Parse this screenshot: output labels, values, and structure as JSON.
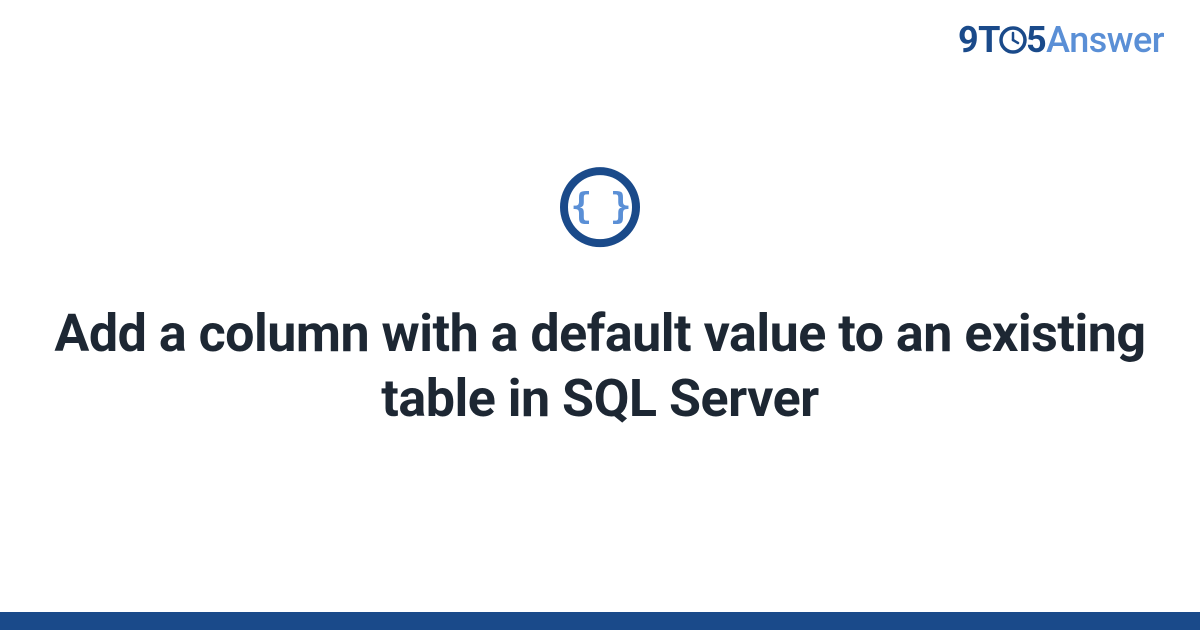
{
  "logo": {
    "part1": "9T",
    "part2": "5",
    "part3": "Answer",
    "clock_icon": "clock-icon"
  },
  "icon": {
    "braces": "{ }",
    "name": "code-braces-icon"
  },
  "title": "Add a column with a default value to an existing table in SQL Server",
  "colors": {
    "dark_blue": "#1a4a8a",
    "light_blue": "#5a8fd6",
    "text_dark": "#1d2733"
  }
}
